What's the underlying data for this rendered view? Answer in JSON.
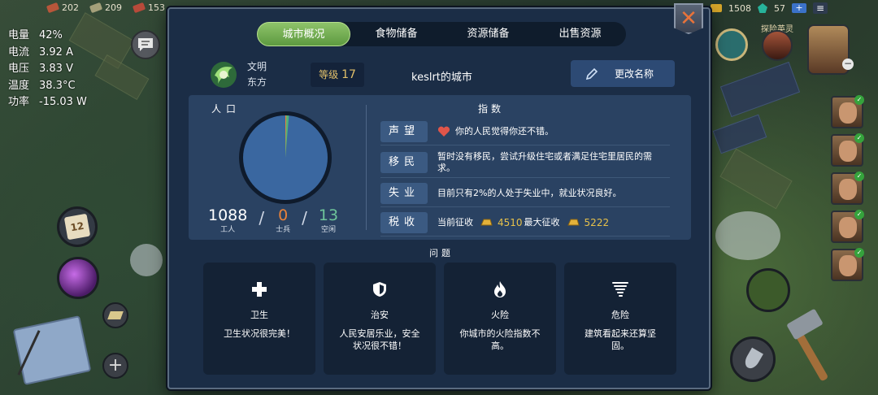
{
  "top_resources": [
    {
      "icon": "wood-icon",
      "value": "202"
    },
    {
      "icon": "stone-icon",
      "value": "209"
    },
    {
      "icon": "meat-icon",
      "value": "153"
    }
  ],
  "top_right": {
    "gold": "1508",
    "gems": "57",
    "plus": "+",
    "menu": "≡"
  },
  "device_stats": [
    {
      "label": "电量",
      "value": "42%"
    },
    {
      "label": "电流",
      "value": "3.92 A"
    },
    {
      "label": "电压",
      "value": "3.83 V"
    },
    {
      "label": "温度",
      "value": "38.3°C"
    },
    {
      "label": "功率",
      "value": "-15.03 W"
    }
  ],
  "calendar_day": "12",
  "hero_label": "探险英灵",
  "tabs": [
    {
      "label": "城市概况",
      "active": true
    },
    {
      "label": "食物储备",
      "active": false
    },
    {
      "label": "资源储备",
      "active": false
    },
    {
      "label": "出售资源",
      "active": false
    }
  ],
  "header": {
    "civ_label": "文明",
    "civ_name": "东方",
    "level_label": "等级",
    "level_value": "17",
    "city_name": "keslrt的城市",
    "rename_label": "更改名称"
  },
  "population": {
    "title": "人口",
    "workers": {
      "value": "1088",
      "label": "工人"
    },
    "soldiers": {
      "value": "0",
      "label": "士兵"
    },
    "idle": {
      "value": "13",
      "label": "空闲"
    }
  },
  "indices": {
    "title": "指数",
    "rows": [
      {
        "label": "声望",
        "text": "你的人民觉得你还不错。"
      },
      {
        "label": "移民",
        "text": "暂时没有移民，尝试升级住宅或者满足住宅里居民的需求。"
      },
      {
        "label": "失业",
        "text": "目前只有2%的人处于失业中，就业状况良好。"
      },
      {
        "label": "税收",
        "text_current": "当前征收",
        "current_value": "4510",
        "text_max": "最大征收",
        "max_value": "5222"
      }
    ]
  },
  "problems": {
    "title": "问题",
    "cards": [
      {
        "icon": "health-cross-icon",
        "title": "卫生",
        "desc": "卫生状况很完美！"
      },
      {
        "icon": "shield-icon",
        "title": "治安",
        "desc": "人民安居乐业，安全状况很不错！"
      },
      {
        "icon": "fire-icon",
        "title": "火险",
        "desc": "你城市的火险指数不高。"
      },
      {
        "icon": "tornado-icon",
        "title": "危险",
        "desc": "建筑看起来还算坚固。"
      }
    ]
  },
  "colors": {
    "panel": "#1b2d46",
    "tab_active": "#6fae4f",
    "soldiers": "#e8823a",
    "idle": "#6ec49a",
    "gold": "#e7c14a"
  }
}
